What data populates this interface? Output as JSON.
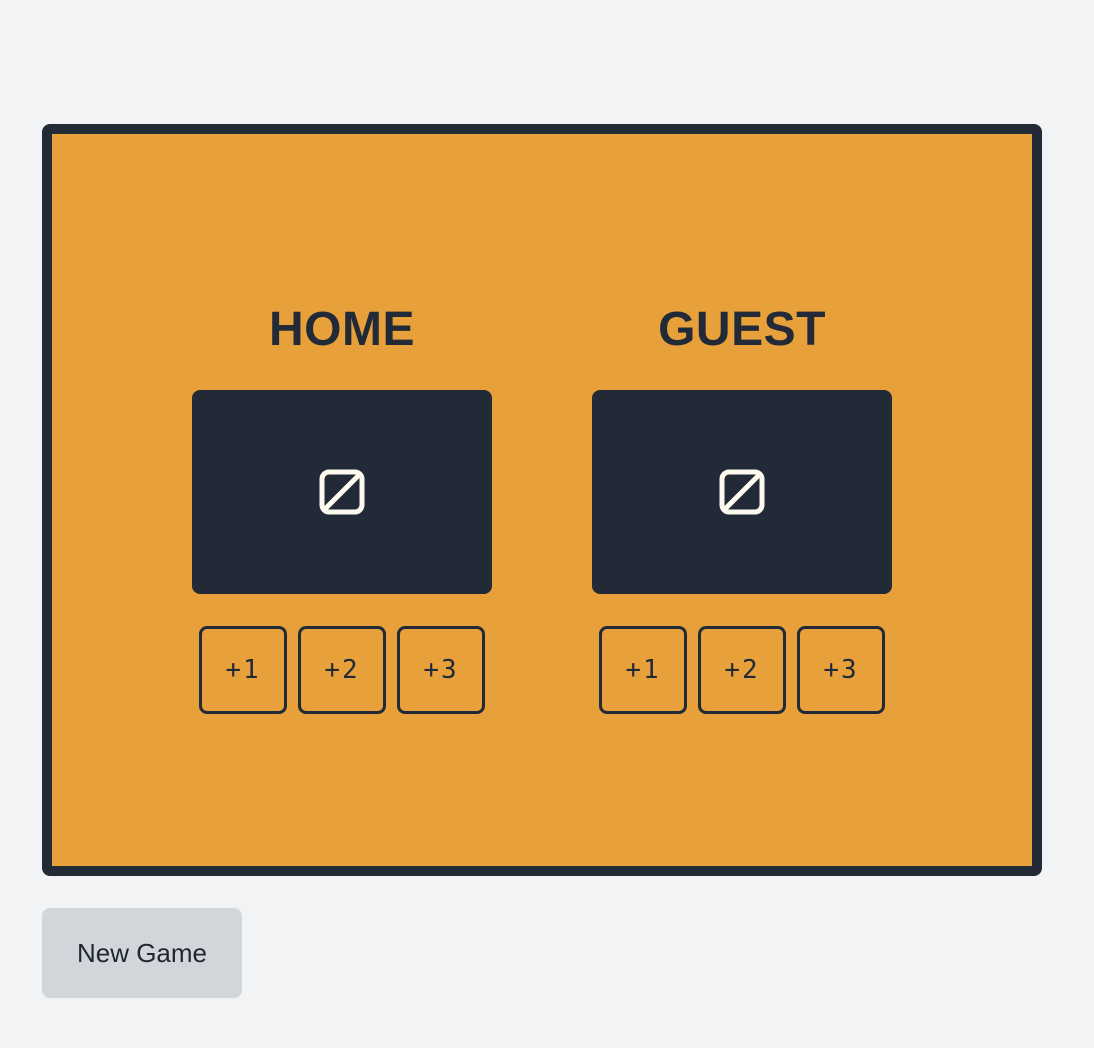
{
  "scoreboard": {
    "home": {
      "name": "HOME",
      "score": "",
      "buttons": [
        "+1",
        "+2",
        "+3"
      ]
    },
    "guest": {
      "name": "GUEST",
      "score": "",
      "buttons": [
        "+1",
        "+2",
        "+3"
      ]
    }
  },
  "actions": {
    "new_game_label": "New Game"
  },
  "icons": {
    "score_placeholder": "missing-glyph-icon"
  },
  "colors": {
    "page_background": "#f2f3f5",
    "board_background": "#e8a13a",
    "board_border": "#222a38",
    "display_background": "#222a38",
    "display_glyph": "#fffaf0",
    "new_game_background": "#d2d5d9"
  }
}
